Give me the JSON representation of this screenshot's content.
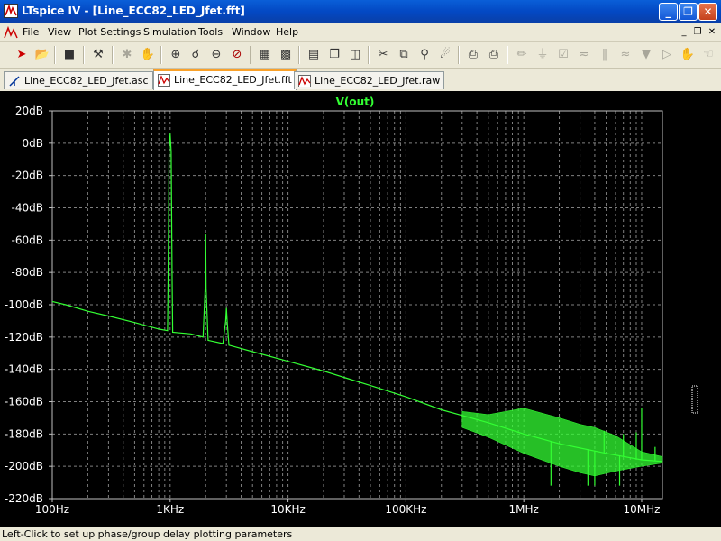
{
  "window": {
    "title": "LTspice IV - [Line_ECC82_LED_Jfet.fft]",
    "controls": [
      "_",
      "❐",
      "✕"
    ]
  },
  "menu": {
    "items": [
      "File",
      "View",
      "Plot Settings",
      "Simulation",
      "Tools",
      "Window",
      "Help"
    ],
    "mdi_controls": [
      "_",
      "❐",
      "✕"
    ]
  },
  "toolbar": {
    "icons": [
      "run-icon",
      "open-icon",
      "save-icon",
      "control-panel-icon",
      "halt-icon",
      "pan-icon",
      "zoom-in-icon",
      "zoom-area-icon",
      "zoom-out-icon",
      "zoom-cancel-icon",
      "autorange-icon",
      "tile-horizontal-icon",
      "cascade-icon",
      "tile-vertical-icon",
      "cut-icon",
      "copy-icon",
      "find-icon",
      "print-preview-icon",
      "print-icon",
      "wire-icon",
      "ground-icon",
      "label-icon",
      "resistor-icon",
      "capacitor-icon",
      "inductor-icon",
      "diode-icon",
      "component-icon",
      "move-icon"
    ]
  },
  "tabs": [
    {
      "label": "Line_ECC82_LED_Jfet.asc",
      "icon": "schematic-icon",
      "active": false
    },
    {
      "label": "Line_ECC82_LED_Jfet.fft",
      "icon": "waveform-icon",
      "active": true
    },
    {
      "label": "Line_ECC82_LED_Jfet.raw",
      "icon": "waveform-icon",
      "active": false
    }
  ],
  "status": {
    "text": "Left-Click to set up phase/group delay plotting parameters"
  },
  "chart_data": {
    "type": "line",
    "title": "V(out)",
    "xscale": "log",
    "xlim": [
      100,
      15000000
    ],
    "ylim": [
      -220,
      20
    ],
    "grid": true,
    "background": "#000000",
    "trace_color": "#33ff33",
    "grid_color": "#808080",
    "x_ticks": [
      {
        "value": 100,
        "label": "100Hz"
      },
      {
        "value": 1000,
        "label": "1KHz"
      },
      {
        "value": 10000,
        "label": "10KHz"
      },
      {
        "value": 100000,
        "label": "100KHz"
      },
      {
        "value": 1000000,
        "label": "1MHz"
      },
      {
        "value": 10000000,
        "label": "10MHz"
      }
    ],
    "y_ticks": [
      {
        "value": 20,
        "label": "20dB"
      },
      {
        "value": 0,
        "label": "0dB"
      },
      {
        "value": -20,
        "label": "-20dB"
      },
      {
        "value": -40,
        "label": "-40dB"
      },
      {
        "value": -60,
        "label": "-60dB"
      },
      {
        "value": -80,
        "label": "-80dB"
      },
      {
        "value": -100,
        "label": "-100dB"
      },
      {
        "value": -120,
        "label": "-120dB"
      },
      {
        "value": -140,
        "label": "-140dB"
      },
      {
        "value": -160,
        "label": "-160dB"
      },
      {
        "value": -180,
        "label": "-180dB"
      },
      {
        "value": -200,
        "label": "-200dB"
      },
      {
        "value": -220,
        "label": "-220dB"
      }
    ],
    "series": [
      {
        "name": "V(out)",
        "points": [
          [
            100,
            -98
          ],
          [
            130,
            -100
          ],
          [
            200,
            -104
          ],
          [
            300,
            -107
          ],
          [
            500,
            -111
          ],
          [
            800,
            -115
          ],
          [
            950,
            -116
          ],
          [
            960,
            -85
          ],
          [
            980,
            -5
          ],
          [
            1000,
            6
          ],
          [
            1020,
            -5
          ],
          [
            1040,
            -85
          ],
          [
            1050,
            -117
          ],
          [
            1500,
            -118
          ],
          [
            1900,
            -120
          ],
          [
            1980,
            -90
          ],
          [
            2000,
            -56
          ],
          [
            2020,
            -90
          ],
          [
            2100,
            -122
          ],
          [
            2800,
            -124
          ],
          [
            2960,
            -110
          ],
          [
            3000,
            -102
          ],
          [
            3040,
            -110
          ],
          [
            3150,
            -125
          ],
          [
            5000,
            -129
          ],
          [
            10000,
            -135
          ],
          [
            20000,
            -141
          ],
          [
            50000,
            -150
          ],
          [
            100000,
            -157
          ],
          [
            200000,
            -165
          ],
          [
            500000,
            -173
          ],
          [
            1000000,
            -180
          ],
          [
            2000000,
            -186
          ],
          [
            5000000,
            -192
          ],
          [
            10000000,
            -196
          ],
          [
            15000000,
            -197
          ]
        ],
        "noise_band": {
          "x": [
            300000,
            500000,
            1000000,
            2000000,
            3000000,
            4000000,
            6000000,
            10000000,
            15000000
          ],
          "upper": [
            -166,
            -168,
            -164,
            -170,
            -174,
            -176,
            -181,
            -191,
            -194
          ],
          "lower": [
            -176,
            -182,
            -192,
            -200,
            -204,
            -206,
            -203,
            -200,
            -198
          ]
        },
        "spurs": [
          {
            "x": 1700000,
            "y": -212
          },
          {
            "x": 3500000,
            "y": -212
          },
          {
            "x": 4000000,
            "y": -212
          },
          {
            "x": 4800000,
            "y": -178
          },
          {
            "x": 6500000,
            "y": -212
          },
          {
            "x": 7000000,
            "y": -180
          },
          {
            "x": 9000000,
            "y": -179
          },
          {
            "x": 10000000,
            "y": -164
          },
          {
            "x": 13000000,
            "y": -188
          }
        ]
      }
    ]
  }
}
